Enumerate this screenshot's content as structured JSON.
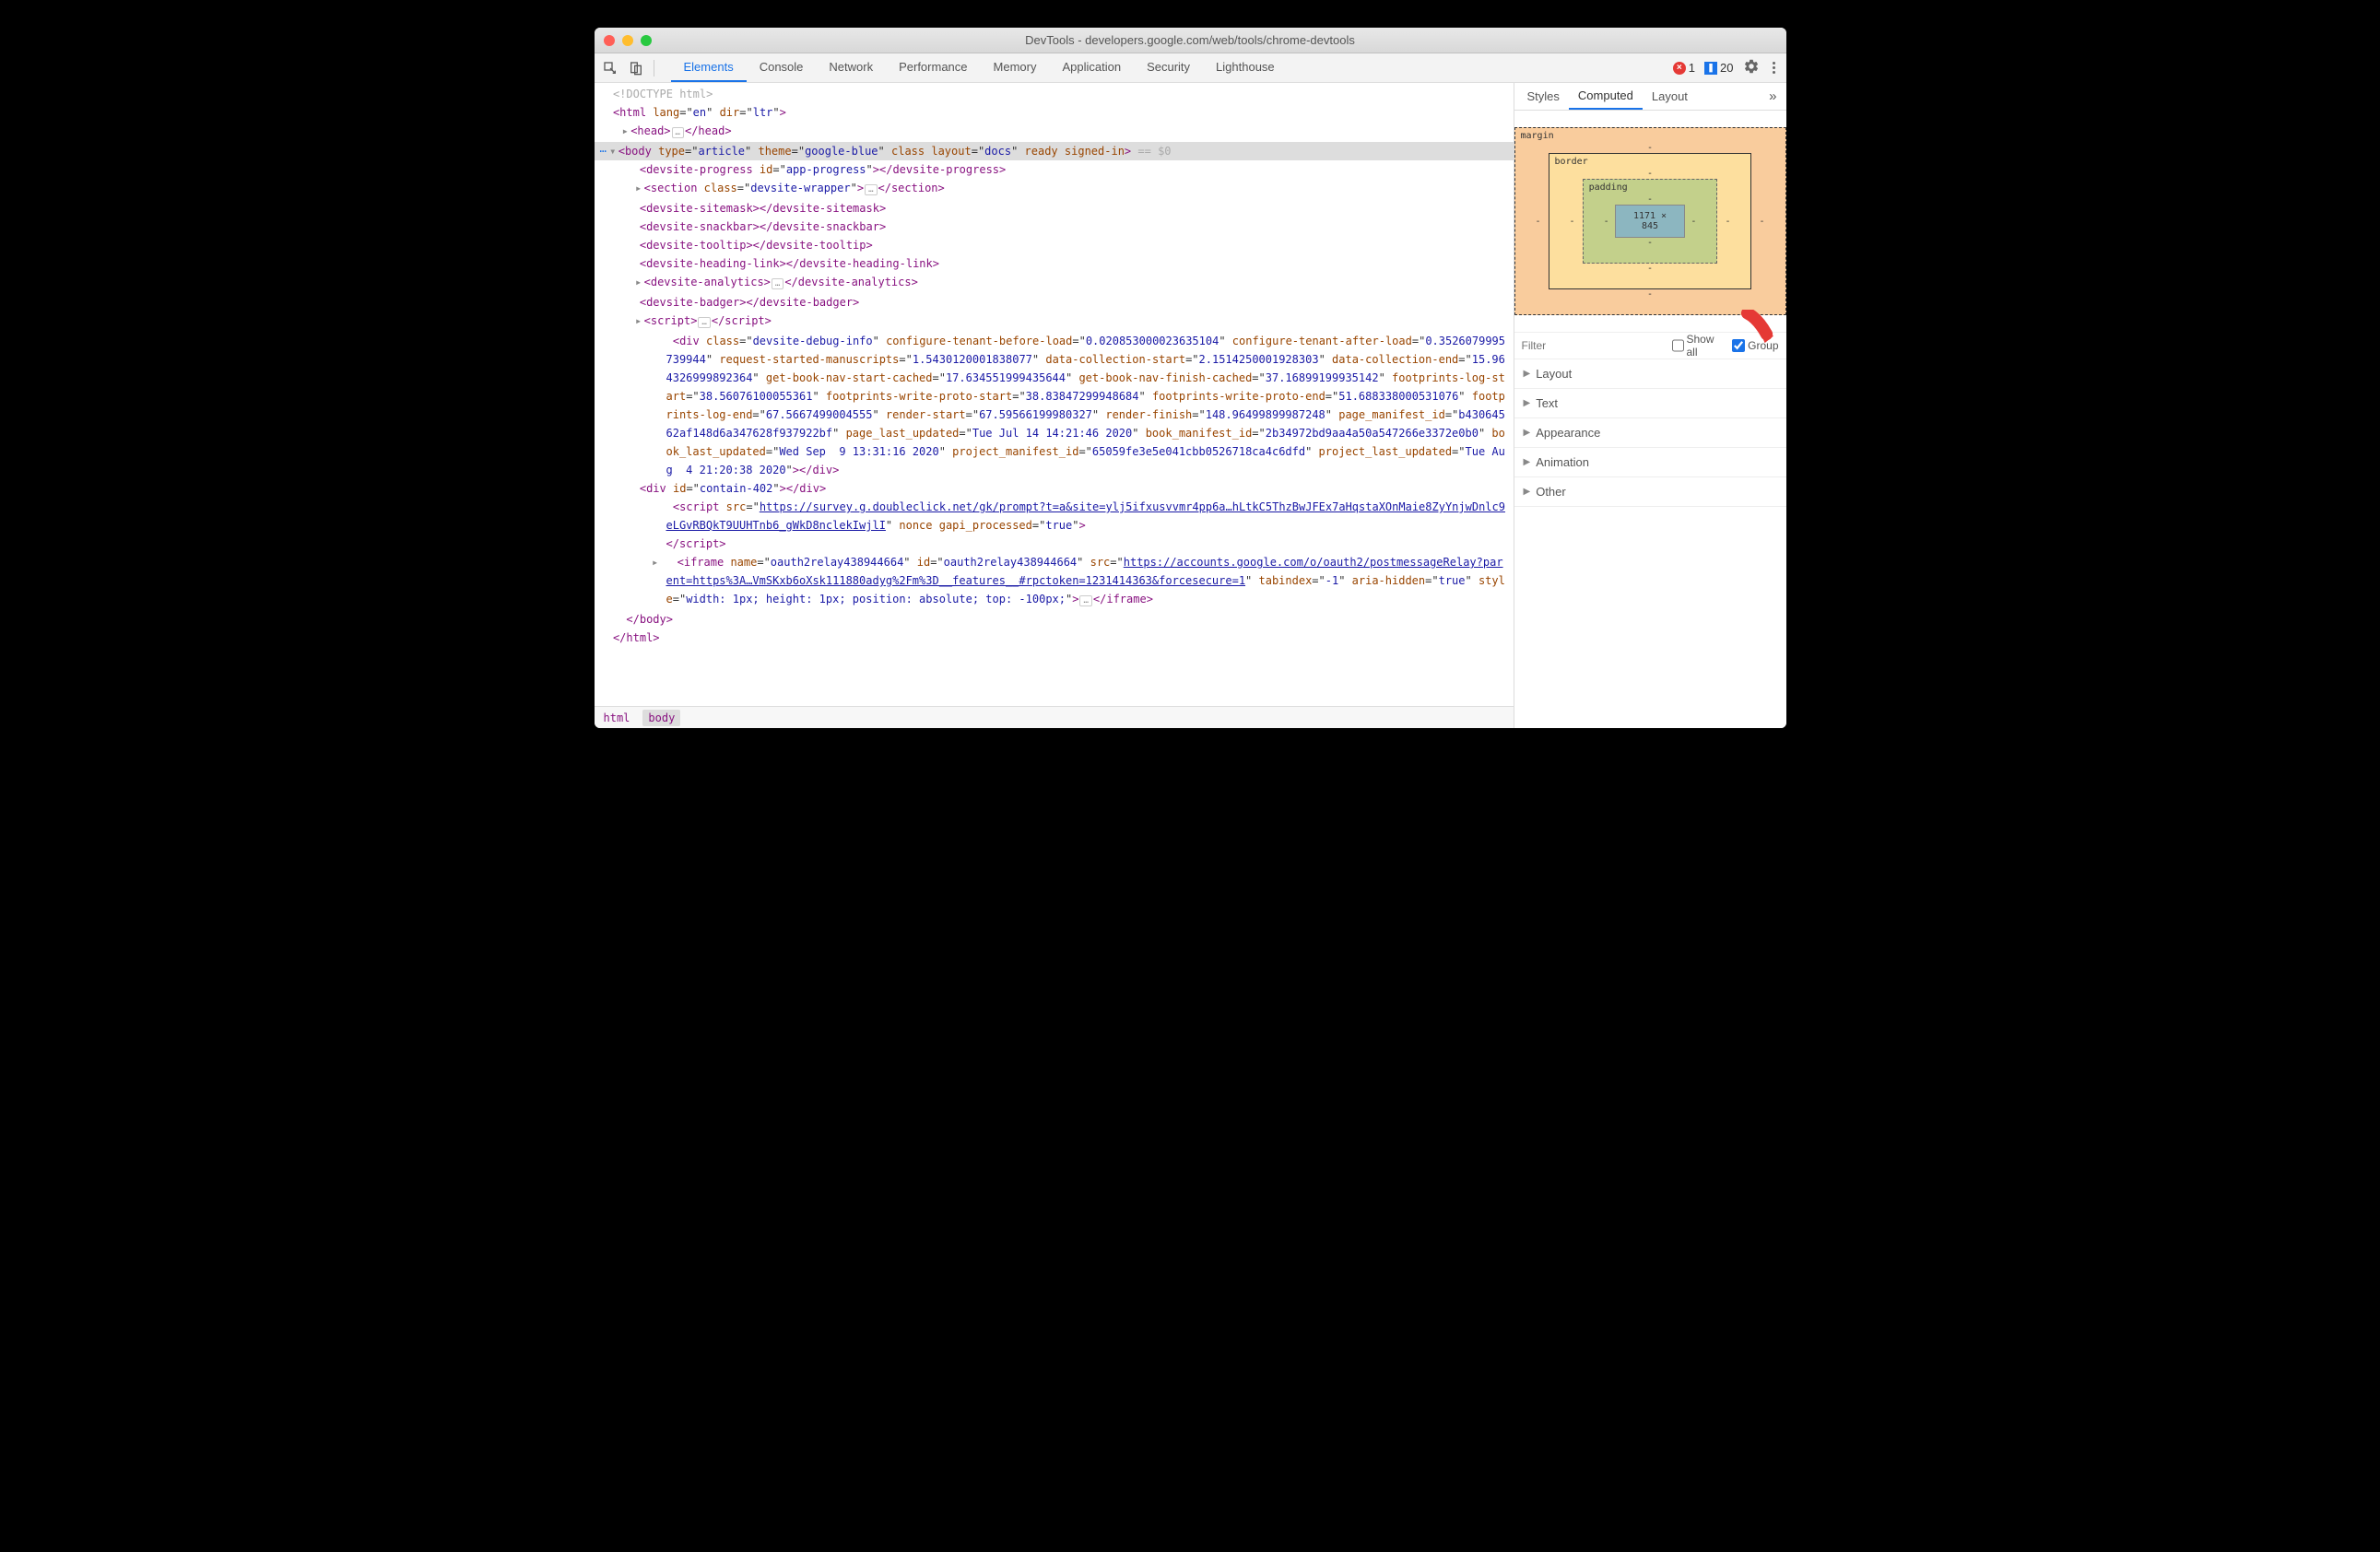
{
  "window": {
    "title": "DevTools - developers.google.com/web/tools/chrome-devtools"
  },
  "toolbar": {
    "tabs": [
      "Elements",
      "Console",
      "Network",
      "Performance",
      "Memory",
      "Application",
      "Security",
      "Lighthouse"
    ],
    "activeTab": 0,
    "errors": "1",
    "messages": "20"
  },
  "breadcrumb": {
    "items": [
      "html",
      "body"
    ],
    "active": 1
  },
  "side": {
    "tabs": [
      "Styles",
      "Computed",
      "Layout"
    ],
    "activeTab": 1,
    "boxModel": {
      "content": "1171 × 845",
      "margin": "margin",
      "border": "border",
      "padding": "padding"
    },
    "filter": {
      "placeholder": "Filter",
      "showAll": "Show all",
      "group": "Group"
    },
    "sections": [
      "Layout",
      "Text",
      "Appearance",
      "Animation",
      "Other"
    ]
  },
  "dom": {
    "doctype": "<!DOCTYPE html>",
    "iframeUrl": "https://accounts.google.com/o/oauth2/postmessageRelay?parent=https%3A…VmSKxb6oXsk111880adyg%2Fm%3D__features__#rpctoken=1231414363&forcesecure=1",
    "scriptUrl": "https://survey.g.doubleclick.net/gk/prompt?t=a&site=ylj5ifxusvvmr4pp6a…hLtkC5ThzBwJFEx7aHqstaXOnMaie8ZyYnjwDnlc9eLGvRBQkT9UUHTnb6_gWkD8nclekIwjlI"
  }
}
